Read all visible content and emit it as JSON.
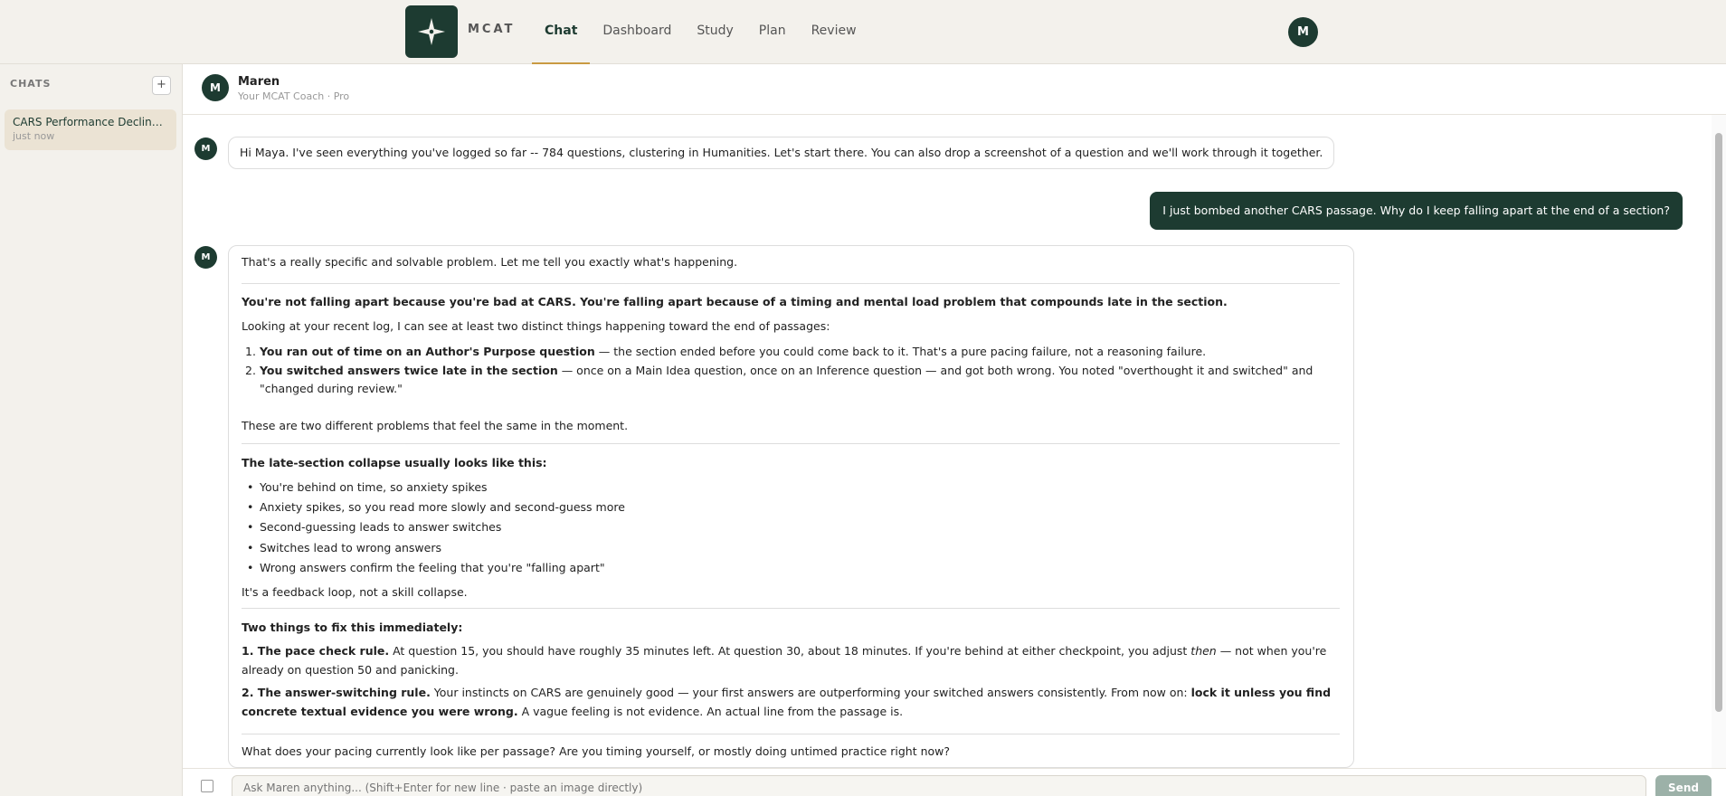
{
  "app": {
    "brand": "MCAT",
    "user_initial": "M"
  },
  "nav": {
    "items": [
      {
        "label": "Chat",
        "active": true
      },
      {
        "label": "Dashboard",
        "active": false
      },
      {
        "label": "Study",
        "active": false
      },
      {
        "label": "Plan",
        "active": false
      },
      {
        "label": "Review",
        "active": false
      }
    ]
  },
  "sidebar": {
    "heading": "CHATS",
    "add_label": "+",
    "chats": [
      {
        "title": "CARS Performance Decline ...",
        "time": "just now"
      }
    ]
  },
  "coach": {
    "initial": "M",
    "name": "Maren",
    "subtitle": "Your MCAT Coach · Pro"
  },
  "messages": {
    "intro": "Hi Maya. I've seen everything you've logged so far -- 784 questions, clustering in Humanities. Let's start there. You can also drop a screenshot of a question and we'll work through it together.",
    "user": "I just bombed another CARS passage. Why do I keep falling apart at the end of a section?",
    "reply": {
      "opening": "That's a really specific and solvable problem. Let me tell you exactly what's happening.",
      "thesis": "You're not falling apart because you're bad at CARS. You're falling apart because of a timing and mental load problem that compounds late in the section.",
      "log_intro": "Looking at your recent log, I can see at least two distinct things happening toward the end of passages:",
      "ol": [
        {
          "bold": "You ran out of time on an Author's Purpose question",
          "text": " — the section ended before you could come back to it. That's a pure pacing failure, not a reasoning failure."
        },
        {
          "bold": "You switched answers twice late in the section",
          "text": " — once on a Main Idea question, once on an Inference question — and got both wrong. You noted \"overthought it and switched\" and \"changed during review.\""
        }
      ],
      "two_problems": "These are two different problems that feel the same in the moment.",
      "collapse_heading": "The late-section collapse usually looks like this:",
      "ul": [
        "You're behind on time, so anxiety spikes",
        "Anxiety spikes, so you read more slowly and second-guess more",
        "Second-guessing leads to answer switches",
        "Switches lead to wrong answers",
        "Wrong answers confirm the feeling that you're \"falling apart\""
      ],
      "loop": "It's a feedback loop, not a skill collapse.",
      "fix_heading": "Two things to fix this immediately:",
      "fix1_bold": "1. The pace check rule.",
      "fix1_text": " At question 15, you should have roughly 35 minutes left. At question 30, about 18 minutes. If you're behind at either checkpoint, you adjust ",
      "fix1_em": "then",
      "fix1_tail": " — not when you're already on question 50 and panicking.",
      "fix2_bold": "2. The answer-switching rule.",
      "fix2_text": " Your instincts on CARS are genuinely good — your first answers are outperforming your switched answers consistently. From now on: ",
      "fix2_bold2": "lock it unless you find concrete textual evidence you were wrong.",
      "fix2_tail": " A vague feeling is not evidence. An actual line from the passage is.",
      "question": "What does your pacing currently look like per passage? Are you timing yourself, or mostly doing untimed practice right now?"
    }
  },
  "composer": {
    "placeholder": "Ask Maren anything... (Shift+Enter for new line · paste an image directly)",
    "send_label": "Send"
  }
}
